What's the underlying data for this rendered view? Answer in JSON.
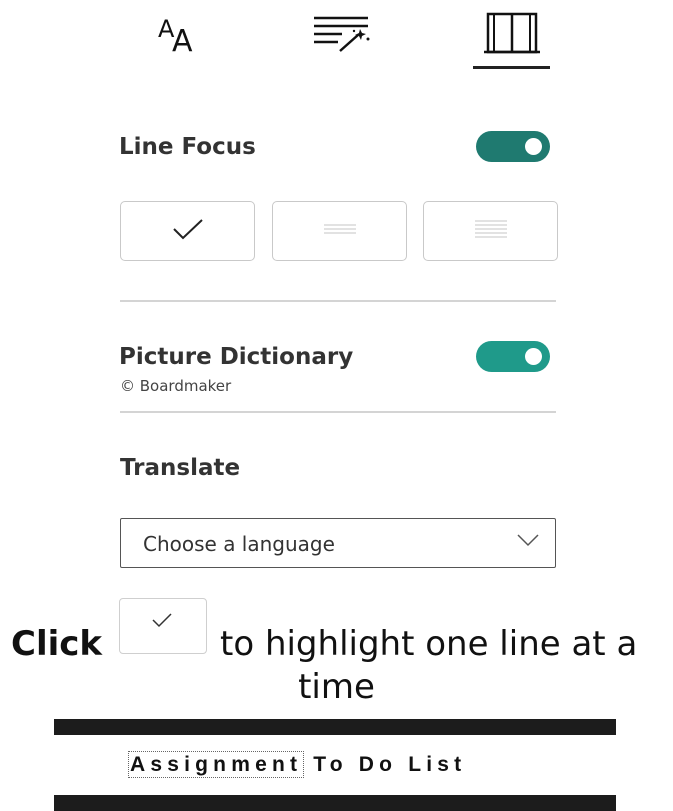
{
  "tabs": [
    {
      "icon": "text-size-icon",
      "selected": false
    },
    {
      "icon": "grammar-options-icon",
      "selected": false
    },
    {
      "icon": "reading-preferences-book-icon",
      "selected": true
    }
  ],
  "line_focus": {
    "title": "Line Focus",
    "enabled": true,
    "options": [
      {
        "icon": "checkmark-icon",
        "selected": true
      },
      {
        "icon": "three-lines-icon",
        "selected": false
      },
      {
        "icon": "five-lines-icon",
        "selected": false
      }
    ]
  },
  "picture_dictionary": {
    "title": "Picture Dictionary",
    "credit": "© Boardmaker",
    "enabled": true
  },
  "translate": {
    "title": "Translate",
    "select_value": "Choose a language"
  },
  "instruction": {
    "bold": "Click",
    "rest": "to highlight one line at a",
    "line2": "time"
  },
  "banner": {
    "word1": "Assignment",
    "word2": "To Do List"
  },
  "colors": {
    "toggle_line_focus": "#1f7a70",
    "toggle_picture_dictionary": "#1f9a8a"
  }
}
